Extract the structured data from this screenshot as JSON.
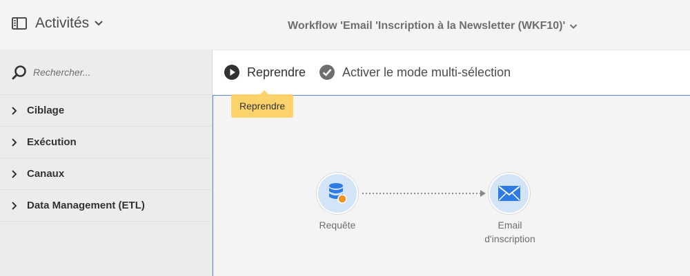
{
  "header": {
    "panel_title": "Activités",
    "workflow_title": "Workflow 'Email 'Inscription à la Newsletter (WKF10)'"
  },
  "sidebar": {
    "search_placeholder": "Rechercher...",
    "categories": [
      {
        "label": "Ciblage"
      },
      {
        "label": "Exécution"
      },
      {
        "label": "Canaux"
      },
      {
        "label": "Data Management (ETL)"
      }
    ]
  },
  "toolbar": {
    "resume_label": "Reprendre",
    "multi_select_label": "Activer le mode multi-sélection"
  },
  "tooltip": {
    "text": "Reprendre"
  },
  "workflow": {
    "nodes": [
      {
        "label": "Requête",
        "icon": "database-query-icon"
      },
      {
        "label_line1": "Email",
        "label_line2": "d'inscription",
        "icon": "envelope-icon"
      }
    ],
    "connector": "dotted-arrow"
  },
  "colors": {
    "accent_blue": "#2d7be5",
    "node_fill": "#d3e4f6",
    "warning_dot": "#f29423",
    "tooltip_bg": "#fcd36a",
    "selection_border": "#5b8ed6"
  }
}
